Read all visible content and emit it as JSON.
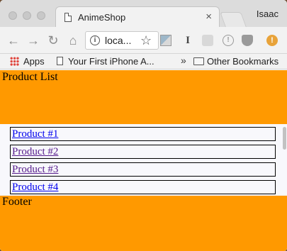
{
  "browser": {
    "tab_title": "AnimeShop",
    "profile_name": "Isaac",
    "url_text": "loca...",
    "bookmarks": {
      "apps_label": "Apps",
      "item_1": "Your First iPhone A...",
      "more_chevron": "»",
      "other_label": "Other Bookmarks"
    },
    "icons": {
      "back": "←",
      "forward": "→",
      "reload": "↻",
      "home": "⌂",
      "star": "☆",
      "close": "×",
      "info": "i"
    }
  },
  "page": {
    "header_text": "Product List",
    "products": [
      {
        "label": "Product #1",
        "color": "#0000ee"
      },
      {
        "label": "Product #2",
        "color": "#551a8b"
      },
      {
        "label": "Product #3",
        "color": "#551a8b"
      },
      {
        "label": "Product #4",
        "color": "#0000ee"
      }
    ],
    "footer_text": "Footer",
    "colors": {
      "band": "#ff9900",
      "list_background": "#f8f8fc"
    }
  }
}
